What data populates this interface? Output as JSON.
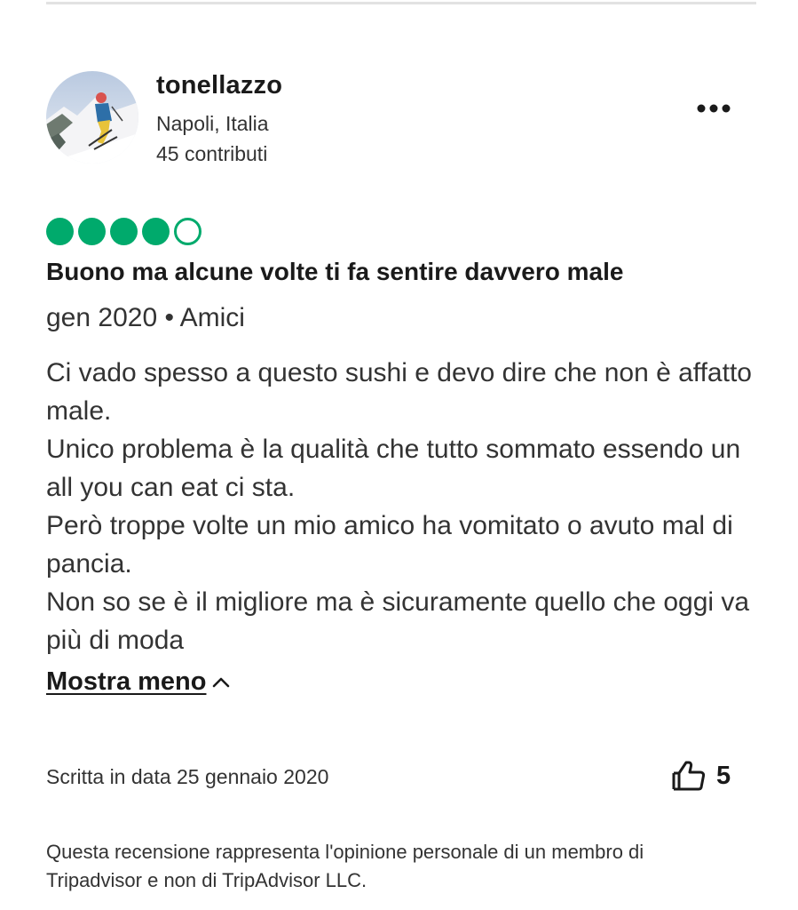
{
  "reviewer": {
    "username": "tonellazzo",
    "location": "Napoli, Italia",
    "contributions": "45 contributi",
    "avatar_icon": "skier-photo"
  },
  "menu": {
    "icon": "more-horizontal-icon"
  },
  "review": {
    "rating": 4,
    "rating_max": 5,
    "rating_color": "#00aa6c",
    "title": "Buono ma alcune volte ti fa sentire davvero male",
    "meta": "gen 2020 • Amici",
    "body": [
      "Ci vado spesso a questo sushi e devo dire che non è affatto male.",
      "Unico problema è la qualità che tutto sommato essendo un all you can eat ci sta.",
      "Però troppe volte un mio amico ha vomitato o avuto mal di pancia.",
      "Non so se è il migliore ma è sicuramente quello che oggi va più di moda"
    ],
    "show_less_label": "Mostra meno",
    "written_date": "Scritta in data 25 gennaio 2020",
    "helpful_count": "5",
    "helpful_icon": "thumbs-up-icon"
  },
  "disclaimer": "Questa recensione rappresenta l'opinione personale di un membro di Tripadvisor e non di TripAdvisor LLC."
}
